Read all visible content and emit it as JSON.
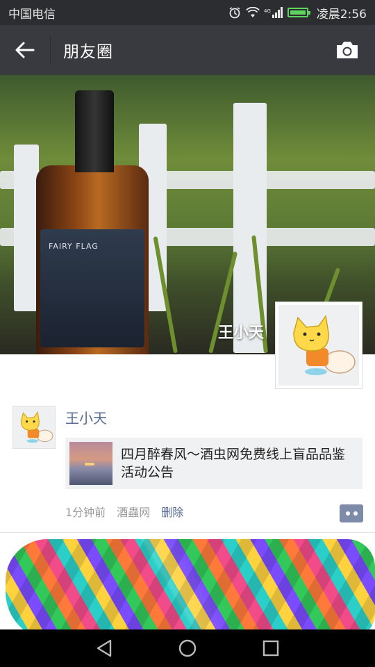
{
  "status_bar": {
    "carrier": "中国电信",
    "network": "4G",
    "time": "凌晨2:56"
  },
  "header": {
    "title": "朋友圈"
  },
  "cover": {
    "username": "王小天",
    "bottle_label": "FAIRY FLAG"
  },
  "post": {
    "author": "王小天",
    "link_title": "四月醉春风～酒虫网免费线上盲品品鉴活动公告",
    "time_ago": "1分钟前",
    "source": "酒蟲网",
    "delete_label": "删除"
  },
  "colors": {
    "name_blue": "#576b95",
    "topbar": "#393a3f",
    "status_bar": "#2b2d30"
  }
}
